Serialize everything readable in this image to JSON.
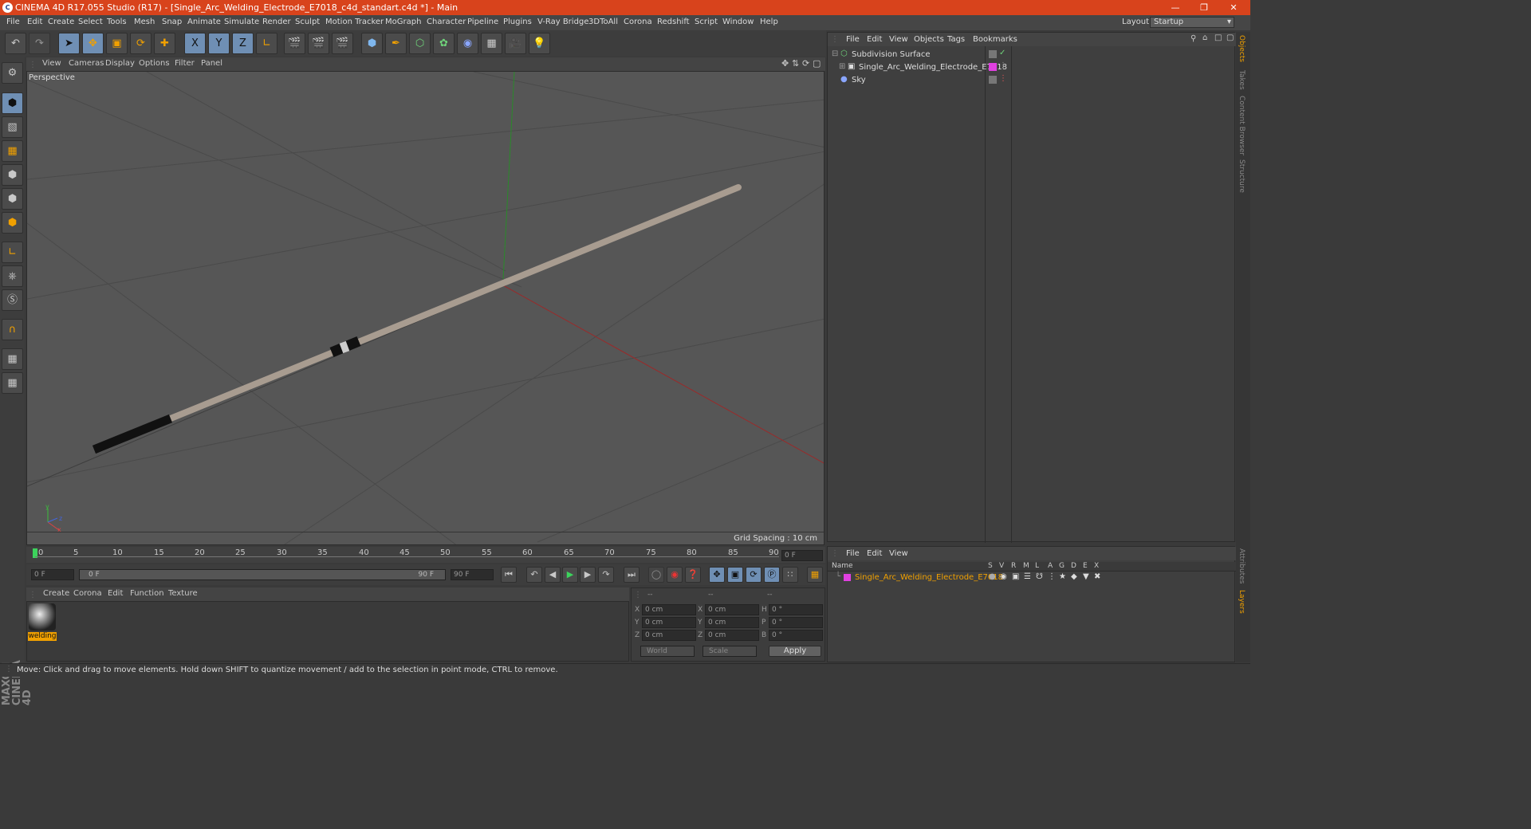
{
  "window": {
    "title": "CINEMA 4D R17.055 Studio (R17) - [Single_Arc_Welding_Electrode_E7018_c4d_standart.c4d *] - Main",
    "logo": "C"
  },
  "menu": [
    "File",
    "Edit",
    "Create",
    "Select",
    "Tools",
    "Mesh",
    "Snap",
    "Animate",
    "Simulate",
    "Render",
    "Sculpt",
    "Motion Tracker",
    "MoGraph",
    "Character",
    "Pipeline",
    "Plugins",
    "V-Ray Bridge",
    "3DToAll",
    "Corona",
    "Redshift",
    "Script",
    "Window",
    "Help"
  ],
  "layout": {
    "label": "Layout:",
    "value": "Startup"
  },
  "toolbar": {
    "x_label": "X",
    "y_label": "Y",
    "z_label": "Z"
  },
  "viewport": {
    "menu": [
      "View",
      "Cameras",
      "Display",
      "Options",
      "Filter",
      "Panel"
    ],
    "label": "Perspective",
    "grid_spacing": "Grid Spacing : 10 cm",
    "axis_y": "y",
    "axis_z": "z",
    "axis_x": "x"
  },
  "timeline": {
    "ticks": [
      "0",
      "5",
      "10",
      "15",
      "20",
      "25",
      "30",
      "35",
      "40",
      "45",
      "50",
      "55",
      "60",
      "65",
      "70",
      "75",
      "80",
      "85",
      "90"
    ],
    "current_frame": "0 F",
    "start_field": "0 F",
    "range_start": "0 F",
    "range_end": "90 F",
    "end_field": "90 F"
  },
  "material": {
    "menu": [
      "Create",
      "Corona",
      "Edit",
      "Function",
      "Texture"
    ],
    "name": "welding"
  },
  "coords": {
    "head": [
      "--",
      "--",
      "--"
    ],
    "rows": [
      {
        "a": "X",
        "av": "0 cm",
        "b": "X",
        "bv": "0 cm",
        "c": "H",
        "cv": "0 °"
      },
      {
        "a": "Y",
        "av": "0 cm",
        "b": "Y",
        "bv": "0 cm",
        "c": "P",
        "cv": "0 °"
      },
      {
        "a": "Z",
        "av": "0 cm",
        "b": "Z",
        "bv": "0 cm",
        "c": "B",
        "cv": "0 °"
      }
    ],
    "world": "World",
    "scale": "Scale",
    "apply": "Apply"
  },
  "objects": {
    "menu": [
      "File",
      "Edit",
      "View",
      "Objects",
      "Tags",
      "Bookmarks"
    ],
    "items": [
      {
        "name": "Subdivision Surface",
        "color": "#ddd"
      },
      {
        "name": "Single_Arc_Welding_Electrode_E7018",
        "color": "#ddd"
      },
      {
        "name": "Sky",
        "color": "#ddd"
      }
    ]
  },
  "layers": {
    "menu": [
      "File",
      "Edit",
      "View"
    ],
    "col_name": "Name",
    "cols": [
      "S",
      "V",
      "R",
      "M",
      "L",
      "A",
      "G",
      "D",
      "E",
      "X"
    ],
    "item": "Single_Arc_Welding_Electrode_E7018"
  },
  "side_tabs": [
    "Objects",
    "Takes",
    "Content Browser",
    "Structure"
  ],
  "side_tabs_lower": [
    "Attributes",
    "Layers"
  ],
  "brand": "MAXON CINEMA 4D",
  "status": "Move: Click and drag to move elements. Hold down SHIFT to quantize movement / add to the selection in point mode, CTRL to remove.",
  "colors": {
    "title_bar": "#d8431c",
    "accent": "#f0a000",
    "selected_blue": "#6f8fb4"
  }
}
